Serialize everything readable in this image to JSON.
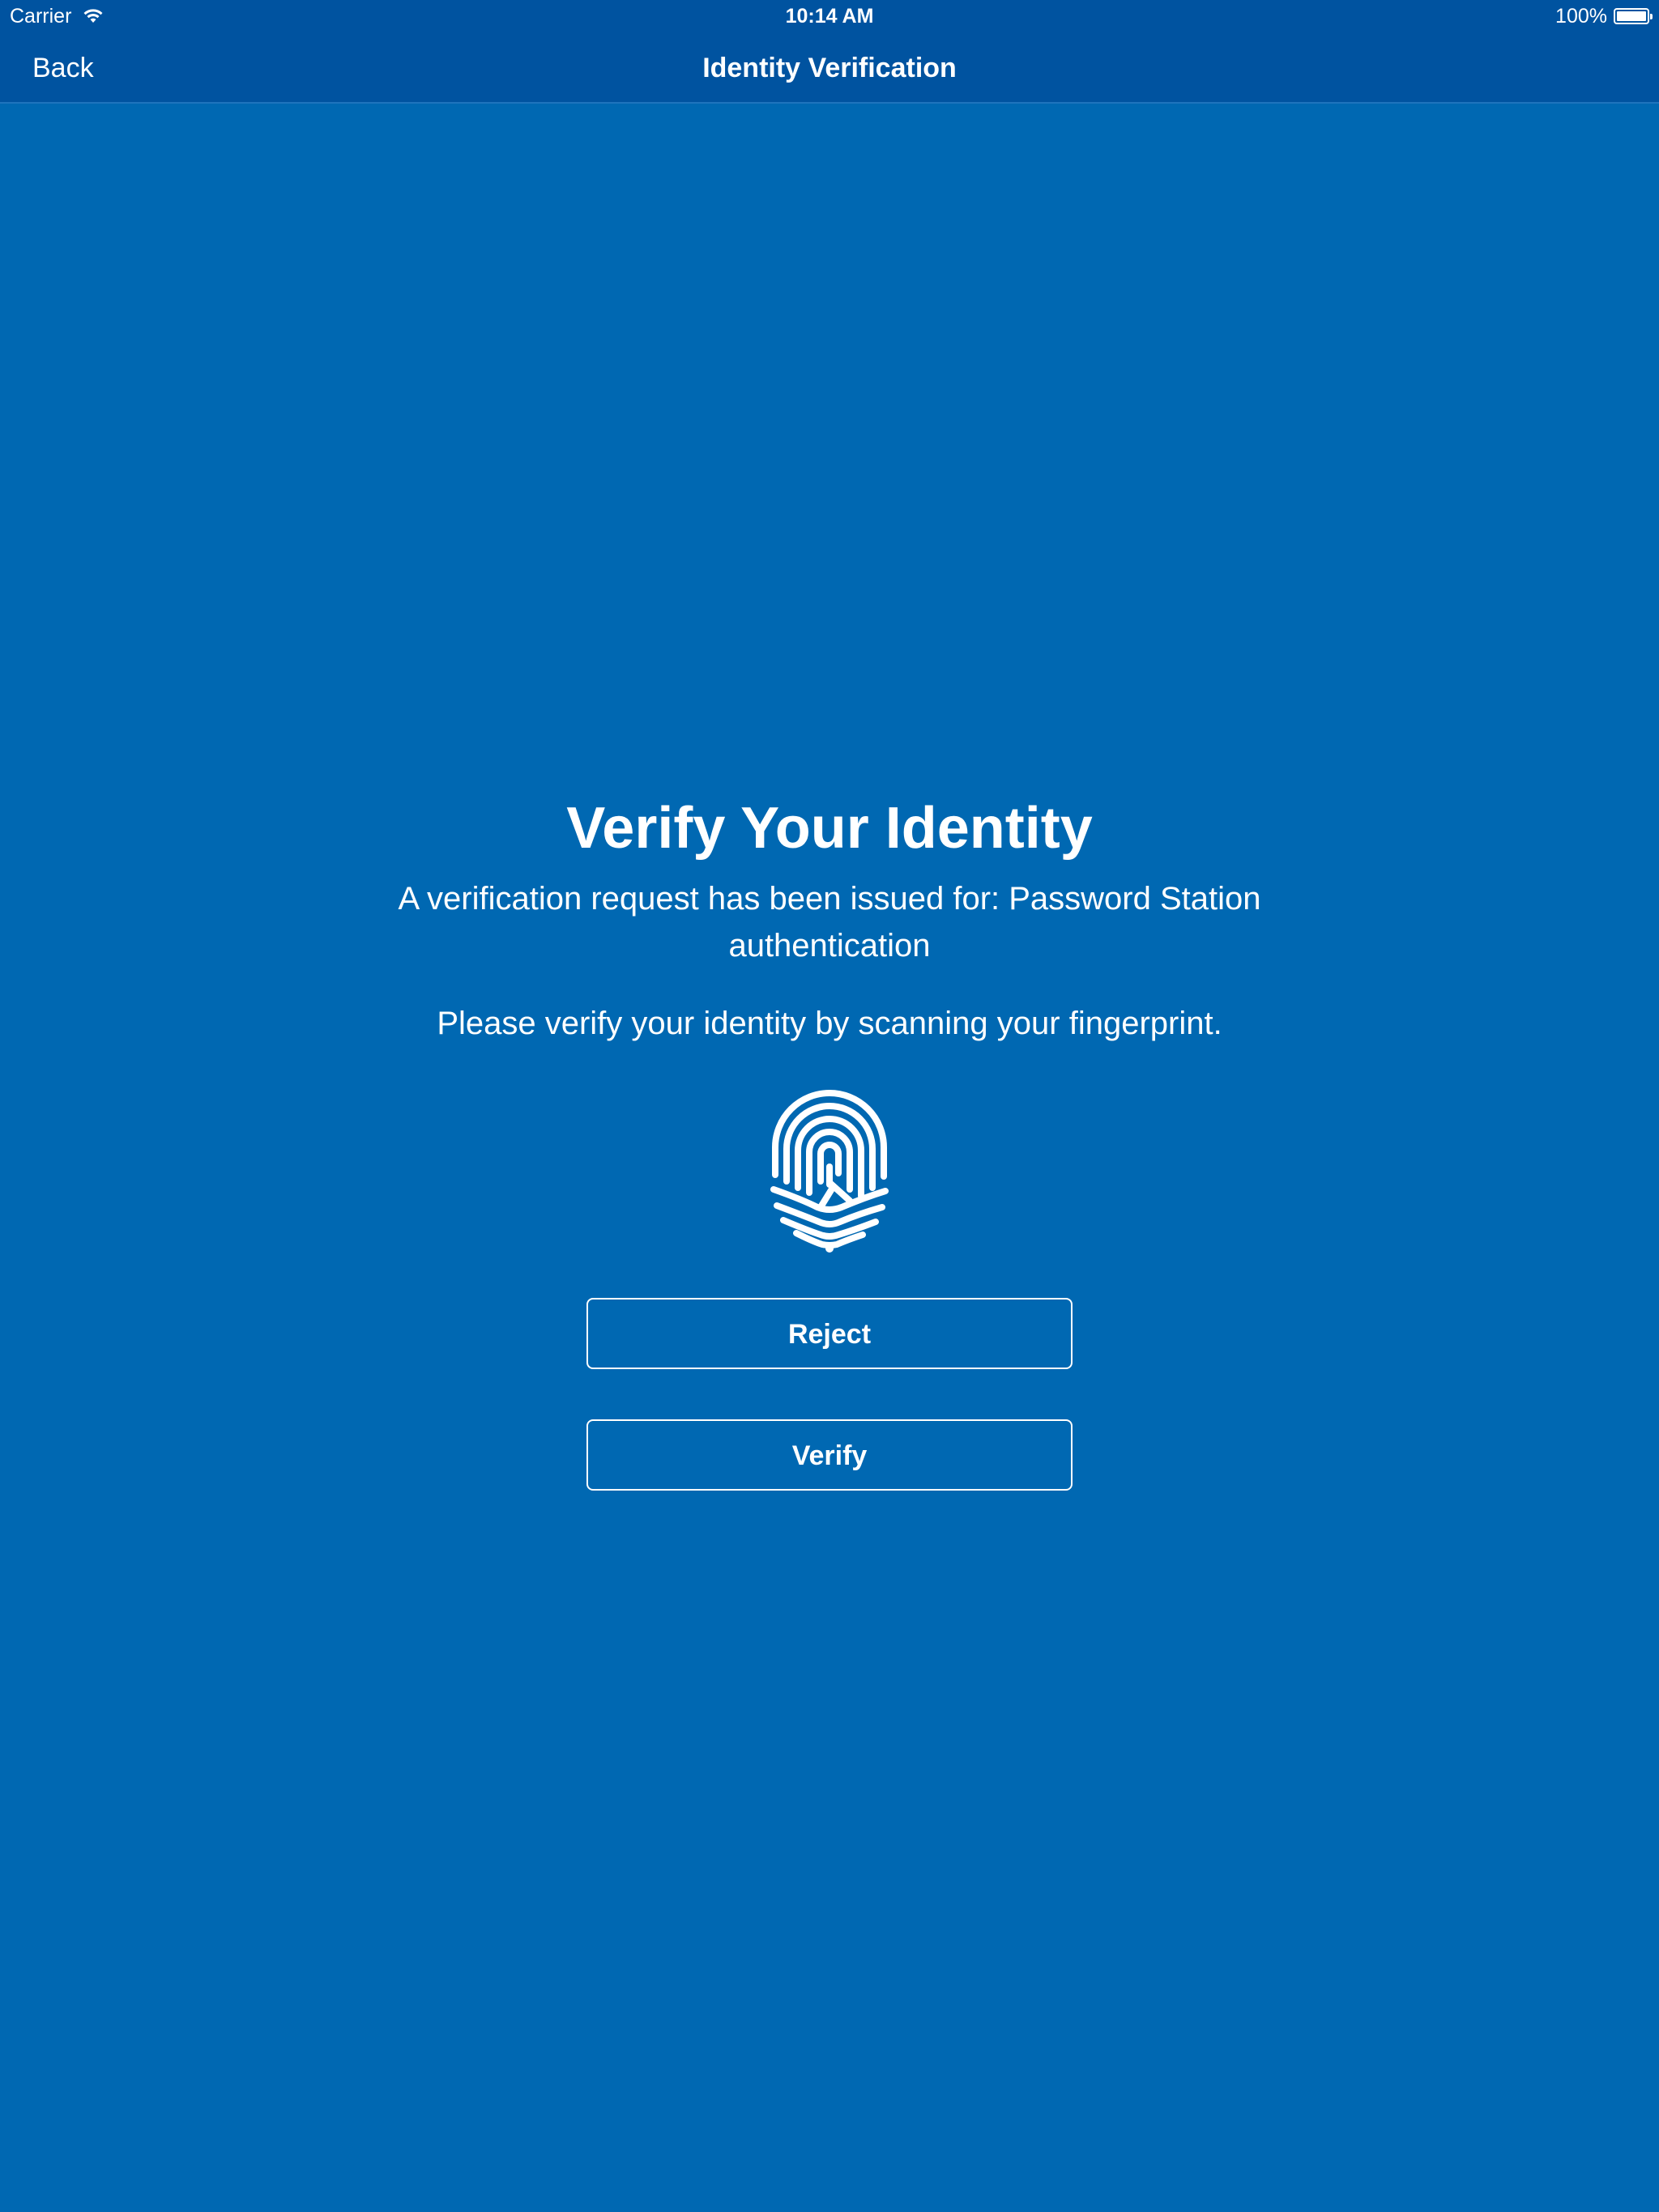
{
  "status_bar": {
    "carrier": "Carrier",
    "time": "10:14 AM",
    "battery_percent": "100%",
    "battery_level": 1.0,
    "wifi_icon": "wifi-icon",
    "battery_icon": "battery-icon"
  },
  "nav": {
    "back_label": "Back",
    "title": "Identity Verification"
  },
  "main": {
    "heading": "Verify Your Identity",
    "request_text": "A verification request has been issued for: Password Station authentication",
    "instruction_text": "Please verify your identity by scanning your fingerprint.",
    "fingerprint_icon": "fingerprint-icon",
    "reject_label": "Reject",
    "verify_label": "Verify"
  },
  "colors": {
    "background": "#0068b2",
    "bar": "#0053a0",
    "text": "#ffffff"
  }
}
